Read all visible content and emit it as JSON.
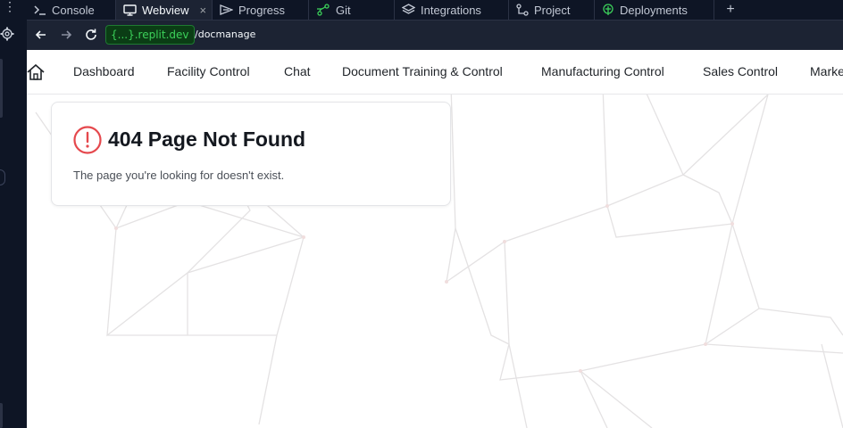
{
  "tabs": [
    {
      "label": "Console",
      "icon": "terminal-icon"
    },
    {
      "label": "Webview",
      "icon": "monitor-icon",
      "active": true
    },
    {
      "label": "Progress",
      "icon": "progress-icon"
    },
    {
      "label": "Git",
      "icon": "git-icon"
    },
    {
      "label": "Integrations",
      "icon": "layers-icon"
    },
    {
      "label": "Project",
      "icon": "project-icon"
    },
    {
      "label": "Deployments",
      "icon": "deploy-icon"
    }
  ],
  "tab_close_glyph": "×",
  "tab_add_glyph": "+",
  "rail_dots": "⋮",
  "address": {
    "host": "{...}.replit.dev",
    "path": "/docmanage"
  },
  "nav": {
    "items": [
      "Dashboard",
      "Facility Control",
      "Chat",
      "Document Training & Control",
      "Manufacturing Control",
      "Sales Control",
      "Marke"
    ]
  },
  "error": {
    "title": "404 Page Not Found",
    "message": "The page you're looking for doesn't exist."
  },
  "colors": {
    "accent_green": "#3cd15a",
    "error_red": "#e5484d",
    "ide_bg": "#0e1525"
  }
}
